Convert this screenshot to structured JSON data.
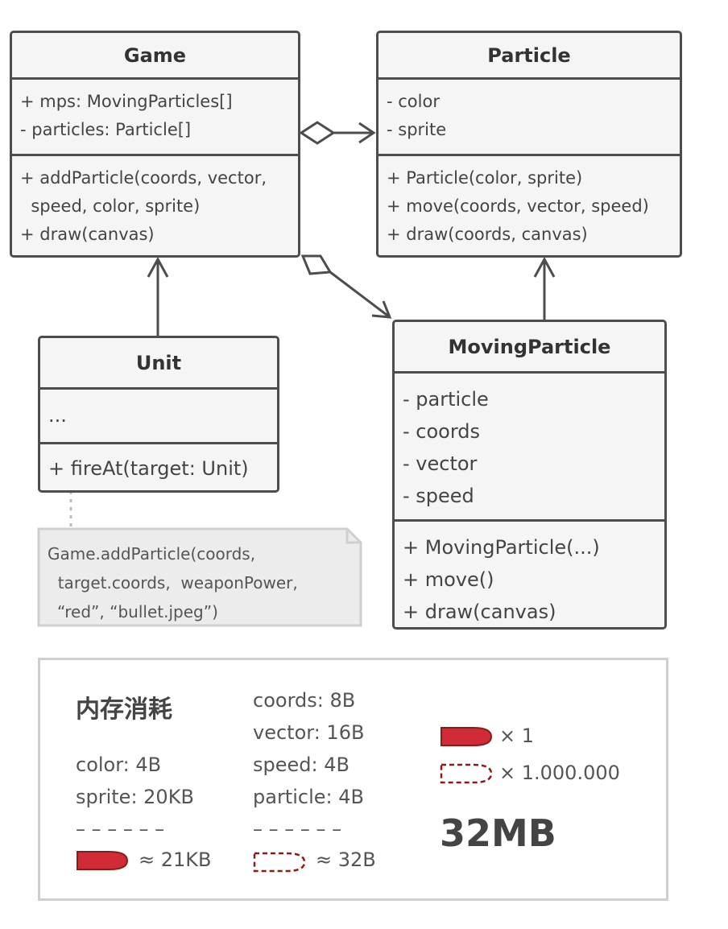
{
  "classes": {
    "game": {
      "name": "Game",
      "fields": [
        "+ mps: MovingParticles[]",
        "- particles: Particle[]"
      ],
      "methods": [
        "+ addParticle(coords, vector,",
        "  speed, color, sprite)",
        "+ draw(canvas)"
      ]
    },
    "particle": {
      "name": "Particle",
      "fields": [
        "- color",
        "- sprite"
      ],
      "methods": [
        "+ Particle(color, sprite)",
        "+ move(coords, vector, speed)",
        "+ draw(coords, canvas)"
      ]
    },
    "unit": {
      "name": "Unit",
      "fields": [
        "..."
      ],
      "methods": [
        "+ fireAt(target: Unit)"
      ]
    },
    "moving_particle": {
      "name": "MovingParticle",
      "fields": [
        "- particle",
        "- coords",
        "- vector",
        "- speed"
      ],
      "methods": [
        "+ MovingParticle(...)",
        "+ move()",
        "+ draw(canvas)"
      ]
    }
  },
  "note": {
    "lines": [
      "Game.addParticle(coords,",
      "  target.coords,  weaponPower,",
      "“red”, “bullet.jpeg”)"
    ]
  },
  "legend": {
    "title": "内存消耗",
    "particle_fields": [
      "color: 4B",
      "sprite: 20KB"
    ],
    "particle_sep": "– – – – – –",
    "particle_total": "≈ 21KB",
    "moving_fields": [
      "coords: 8B",
      "vector: 16B",
      "speed: 4B",
      "particle: 4B"
    ],
    "moving_sep": "– – – – – –",
    "moving_total": "≈ 32B",
    "count_solid": "× 1",
    "count_dashed": "× 1.000.000",
    "total": "32MB"
  },
  "colors": {
    "border": "#4d4d4d",
    "box_fill": "#f5f5f5",
    "note_fill": "#ececec",
    "bullet_red": "#d12b37",
    "bullet_dark_red": "#8b1a1a"
  }
}
